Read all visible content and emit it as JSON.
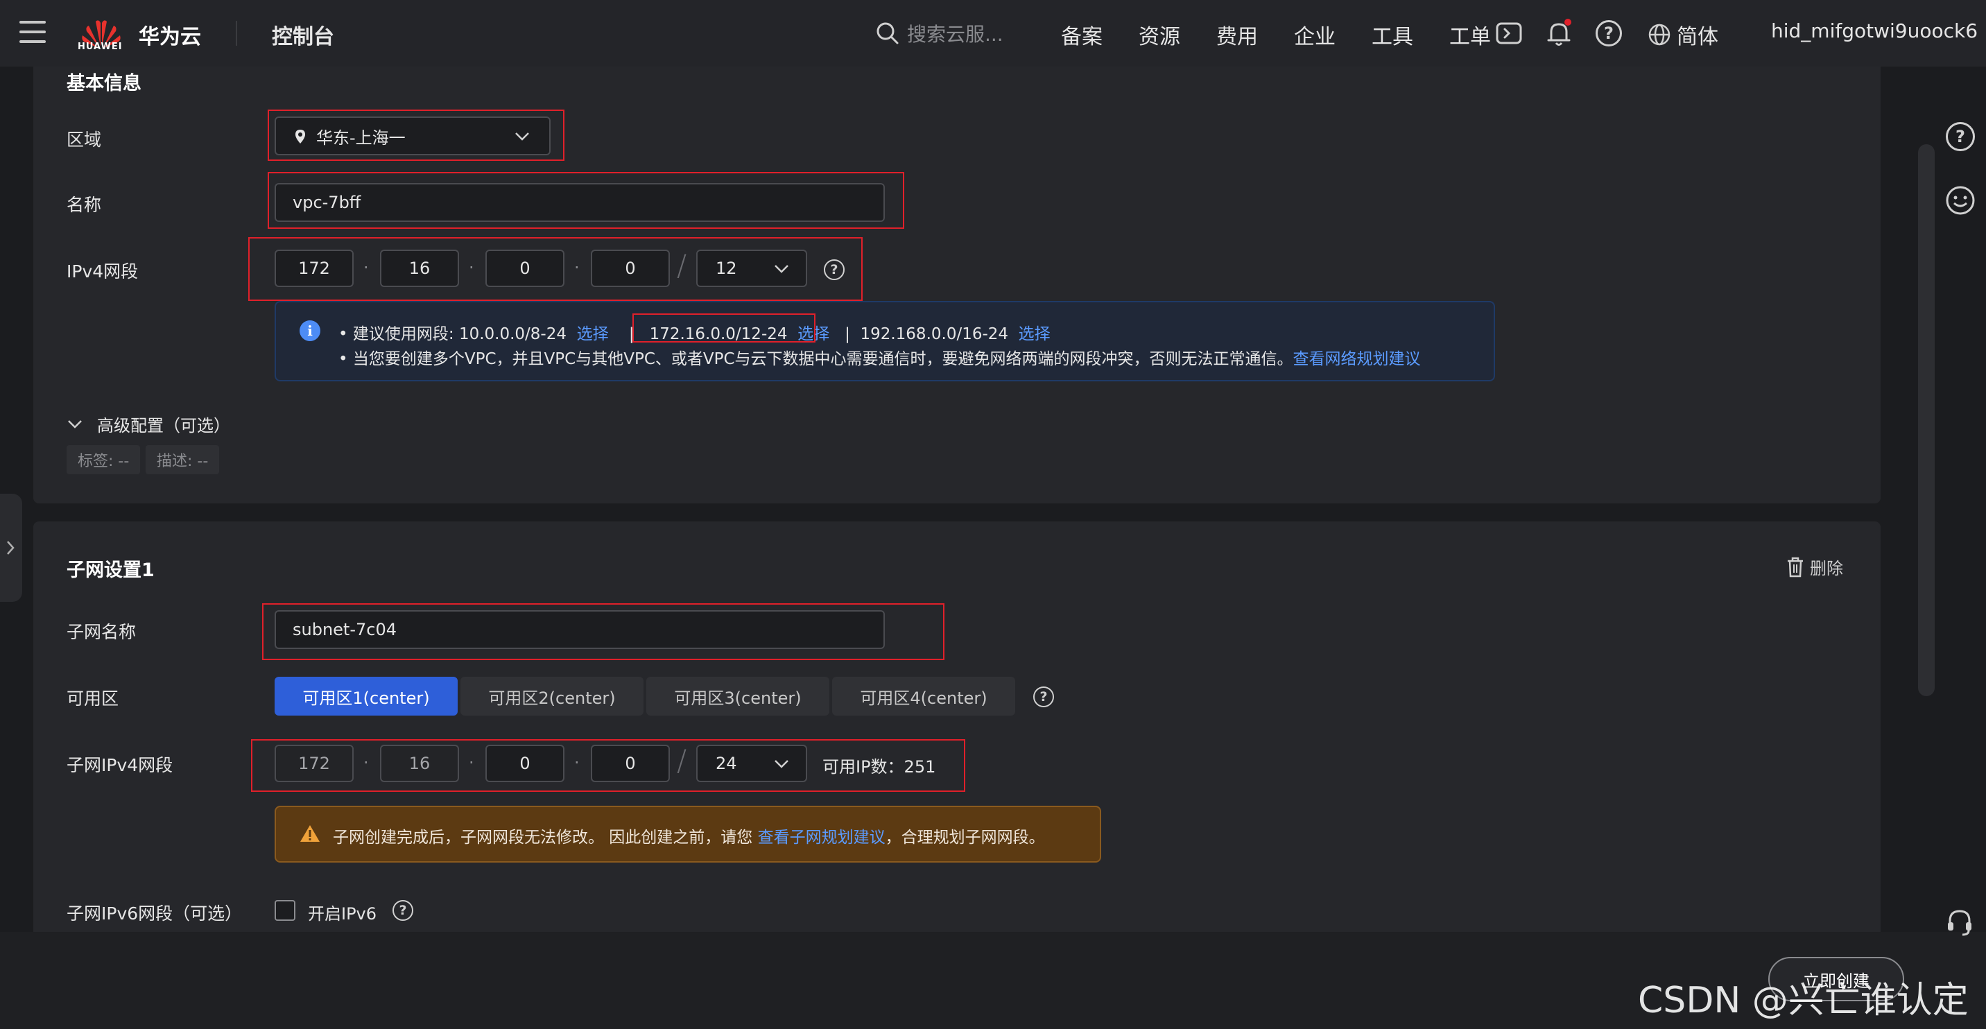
{
  "header": {
    "logo_text": "HUAWEI",
    "brand": "华为云",
    "console": "控制台",
    "search_placeholder": "搜索云服...",
    "nav": [
      "备案",
      "资源",
      "费用",
      "企业",
      "工具",
      "工单"
    ],
    "language": "简体",
    "username": "hid_mifgotwi9uoock6"
  },
  "basic": {
    "title": "基本信息",
    "region_label": "区域",
    "region_value": "华东-上海一",
    "name_label": "名称",
    "name_value": "vpc-7bff",
    "ipv4_label": "IPv4网段",
    "ipv4_octets": [
      "172",
      "16",
      "0",
      "0"
    ],
    "ipv4_mask": "12",
    "info_line1_prefix": "建议使用网段: 10.0.0.0/8-24",
    "info_select_1": "选择",
    "info_sep": "|",
    "info_cidr_2": "172.16.0.0/12-24",
    "info_select_2": "选择",
    "info_cidr_3": "192.168.0.0/16-24",
    "info_select_3": "选择",
    "info_line2": "当您要创建多个VPC，并且VPC与其他VPC、或者VPC与云下数据中心需要通信时，要避免网络两端的网段冲突，否则无法正常通信。",
    "info_link": "查看网络规划建议",
    "advanced": "高级配置（可选）",
    "tag_label": "标签: --",
    "desc_label": "描述: --"
  },
  "subnet": {
    "title": "子网设置1",
    "delete": "删除",
    "name_label": "子网名称",
    "name_value": "subnet-7c04",
    "az_label": "可用区",
    "az_options": [
      "可用区1(center)",
      "可用区2(center)",
      "可用区3(center)",
      "可用区4(center)"
    ],
    "ipv4_label": "子网IPv4网段",
    "ipv4_octets": [
      "172",
      "16",
      "0",
      "0"
    ],
    "ipv4_mask": "24",
    "available_ip": "可用IP数：251",
    "warn_text_pre": "子网创建完成后，子网网段无法修改。 因此创建之前，请您",
    "warn_link": "查看子网规划建议",
    "warn_text_post": "，合理规划子网网段。",
    "ipv6_label": "子网IPv6网段（可选）",
    "ipv6_toggle": "开启IPv6"
  },
  "footer": {
    "create": "立即创建",
    "watermark": "CSDN @兴亡谁认定"
  },
  "colors": {
    "accent": "#2e5fd9",
    "link": "#5b9bff",
    "highlight_box": "#e0202a",
    "warning_bg": "#5c3a12",
    "info_bg": "#202838"
  }
}
